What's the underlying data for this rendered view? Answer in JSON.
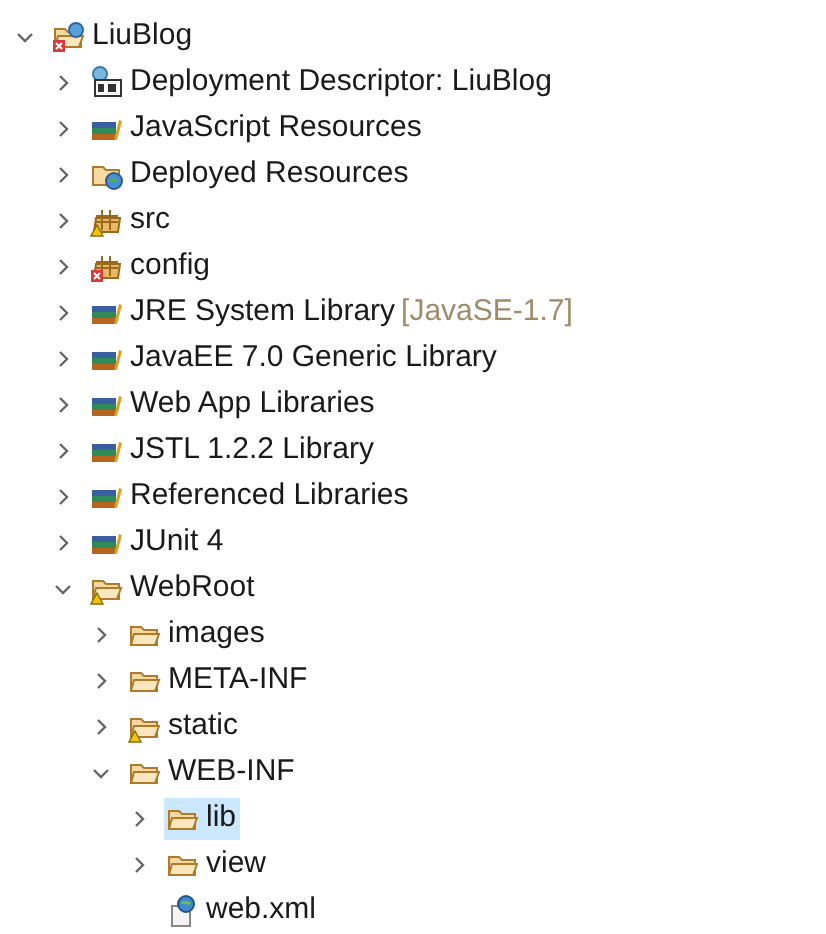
{
  "tree": [
    {
      "label": "LiuBlog",
      "kind": "project",
      "expanded": true,
      "selected": false,
      "children": [
        {
          "label": "Deployment Descriptor: LiuBlog",
          "kind": "descriptor",
          "expanded": false,
          "selected": false
        },
        {
          "label": "JavaScript Resources",
          "kind": "library",
          "expanded": false,
          "selected": false
        },
        {
          "label": "Deployed Resources",
          "kind": "deployed",
          "expanded": false,
          "selected": false
        },
        {
          "label": "src",
          "kind": "package-warning",
          "expanded": false,
          "selected": false
        },
        {
          "label": "config",
          "kind": "package-error",
          "expanded": false,
          "selected": false
        },
        {
          "label": "JRE System Library",
          "decoration": "[JavaSE-1.7]",
          "kind": "library",
          "expanded": false,
          "selected": false
        },
        {
          "label": "JavaEE 7.0 Generic Library",
          "kind": "library",
          "expanded": false,
          "selected": false
        },
        {
          "label": "Web App Libraries",
          "kind": "library",
          "expanded": false,
          "selected": false
        },
        {
          "label": "JSTL 1.2.2 Library",
          "kind": "library",
          "expanded": false,
          "selected": false
        },
        {
          "label": "Referenced Libraries",
          "kind": "library",
          "expanded": false,
          "selected": false
        },
        {
          "label": "JUnit 4",
          "kind": "library",
          "expanded": false,
          "selected": false
        },
        {
          "label": "WebRoot",
          "kind": "folder-warning",
          "expanded": true,
          "selected": false,
          "children": [
            {
              "label": "images",
              "kind": "folder",
              "expanded": false,
              "selected": false
            },
            {
              "label": "META-INF",
              "kind": "folder",
              "expanded": false,
              "selected": false
            },
            {
              "label": "static",
              "kind": "folder-warning",
              "expanded": false,
              "selected": false
            },
            {
              "label": "WEB-INF",
              "kind": "folder",
              "expanded": true,
              "selected": false,
              "children": [
                {
                  "label": "lib",
                  "kind": "folder",
                  "expanded": false,
                  "selected": true
                },
                {
                  "label": "view",
                  "kind": "folder",
                  "expanded": false,
                  "selected": false
                },
                {
                  "label": "web.xml",
                  "kind": "xml",
                  "selected": false
                }
              ]
            }
          ]
        }
      ]
    }
  ]
}
